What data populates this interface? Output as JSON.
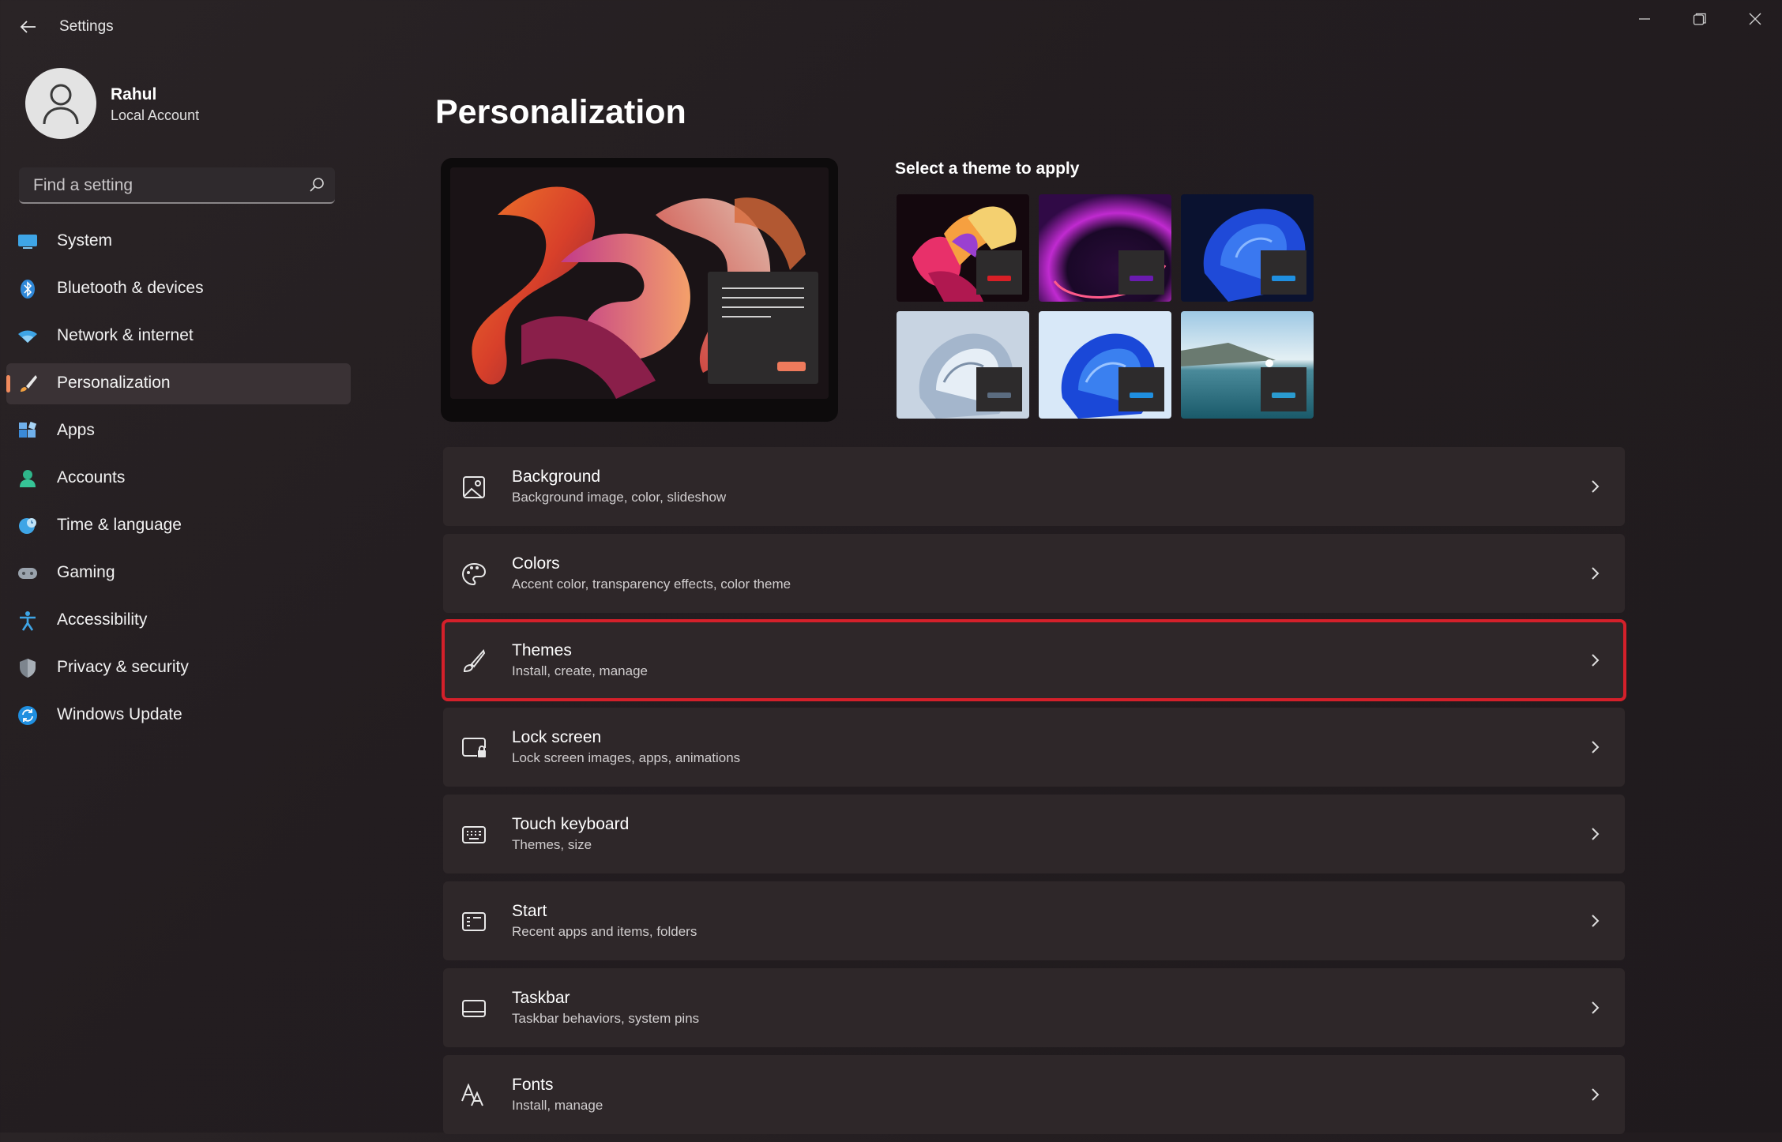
{
  "app": {
    "title": "Settings"
  },
  "user": {
    "name": "Rahul",
    "account_type": "Local Account"
  },
  "search": {
    "placeholder": "Find a setting"
  },
  "sidebar": {
    "items": [
      {
        "label": "System",
        "icon": "monitor-icon"
      },
      {
        "label": "Bluetooth & devices",
        "icon": "bluetooth-icon"
      },
      {
        "label": "Network & internet",
        "icon": "wifi-icon"
      },
      {
        "label": "Personalization",
        "icon": "brush-icon",
        "active": true
      },
      {
        "label": "Apps",
        "icon": "apps-icon"
      },
      {
        "label": "Accounts",
        "icon": "person-icon"
      },
      {
        "label": "Time & language",
        "icon": "globe-clock-icon"
      },
      {
        "label": "Gaming",
        "icon": "gamepad-icon"
      },
      {
        "label": "Accessibility",
        "icon": "accessibility-icon"
      },
      {
        "label": "Privacy & security",
        "icon": "shield-icon"
      },
      {
        "label": "Windows Update",
        "icon": "update-icon"
      }
    ]
  },
  "main": {
    "title": "Personalization",
    "theme_heading": "Select a theme to apply",
    "themes": [
      {
        "name": "glow",
        "accent": "#d81f26"
      },
      {
        "name": "captured-motion",
        "accent": "#6a1bb0"
      },
      {
        "name": "windows-dark",
        "accent": "#1f8fe0"
      },
      {
        "name": "windows-light",
        "accent": "#5b6c80"
      },
      {
        "name": "windows-blue",
        "accent": "#1f8fe0"
      },
      {
        "name": "sunrise-lake",
        "accent": "#2a9bd0"
      }
    ],
    "cards": [
      {
        "title": "Background",
        "subtitle": "Background image, color, slideshow",
        "icon": "image-icon"
      },
      {
        "title": "Colors",
        "subtitle": "Accent color, transparency effects, color theme",
        "icon": "palette-icon"
      },
      {
        "title": "Themes",
        "subtitle": "Install, create, manage",
        "icon": "brush-icon",
        "highlighted": true
      },
      {
        "title": "Lock screen",
        "subtitle": "Lock screen images, apps, animations",
        "icon": "lock-screen-icon"
      },
      {
        "title": "Touch keyboard",
        "subtitle": "Themes, size",
        "icon": "keyboard-icon"
      },
      {
        "title": "Start",
        "subtitle": "Recent apps and items, folders",
        "icon": "start-menu-icon"
      },
      {
        "title": "Taskbar",
        "subtitle": "Taskbar behaviors, system pins",
        "icon": "taskbar-icon"
      },
      {
        "title": "Fonts",
        "subtitle": "Install, manage",
        "icon": "font-icon"
      }
    ]
  },
  "colors": {
    "accent": "#f08a5d",
    "highlight_border": "#d4202a"
  }
}
